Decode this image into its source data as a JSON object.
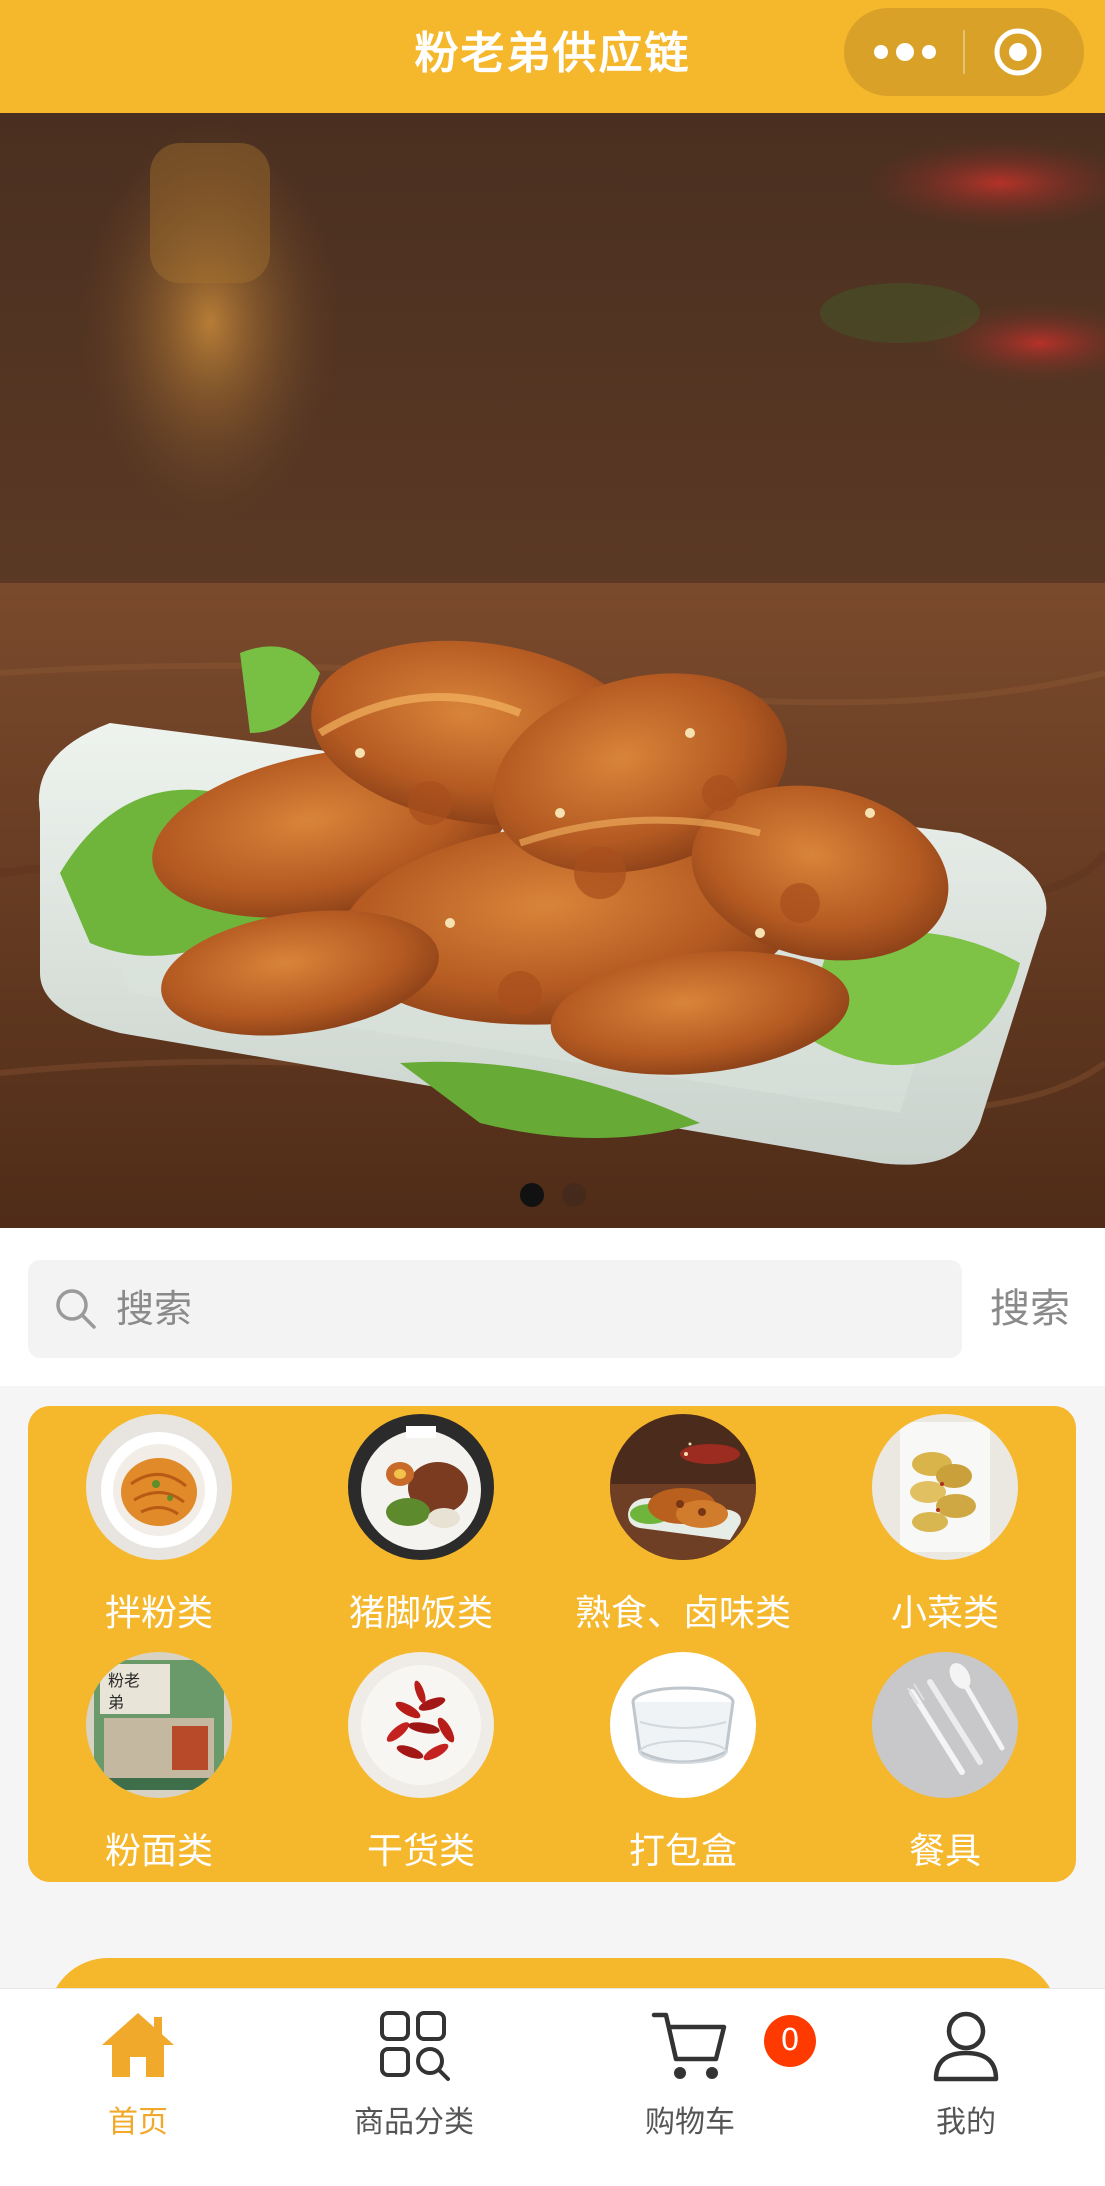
{
  "header": {
    "title": "粉老弟供应链",
    "background": "#f5b72c",
    "more_icon": "more-dots-icon",
    "close_icon": "target-circle-icon"
  },
  "banner": {
    "image": "braised-lotus-root-platter",
    "slide_count": 2,
    "active_slide": 1
  },
  "search": {
    "placeholder": "搜索",
    "value": "",
    "button_label": "搜索",
    "icon": "search-icon"
  },
  "categories": [
    {
      "label": "拌粉类",
      "image": "mixed-rice-noodles-bowl"
    },
    {
      "label": "猪脚饭类",
      "image": "pork-trotter-rice-plate"
    },
    {
      "label": "熟食、卤味类",
      "image": "braised-lotus-root-plate"
    },
    {
      "label": "小菜类",
      "image": "pickled-side-dish"
    },
    {
      "label": "粉面类",
      "image": "noodle-package"
    },
    {
      "label": "干货类",
      "image": "dried-chili-peppers"
    },
    {
      "label": "打包盒",
      "image": "plastic-takeout-container"
    },
    {
      "label": "餐具",
      "image": "spoon-fork-knife"
    }
  ],
  "tabbar": {
    "items": [
      {
        "label": "首页",
        "icon": "home-icon",
        "active": true
      },
      {
        "label": "商品分类",
        "icon": "grid-search-icon",
        "active": false
      },
      {
        "label": "购物车",
        "icon": "cart-icon",
        "active": false
      },
      {
        "label": "我的",
        "icon": "user-icon",
        "active": false
      }
    ],
    "cart_badge": "0",
    "active_color": "#f0a92a",
    "badge_color": "#ff3a00"
  }
}
